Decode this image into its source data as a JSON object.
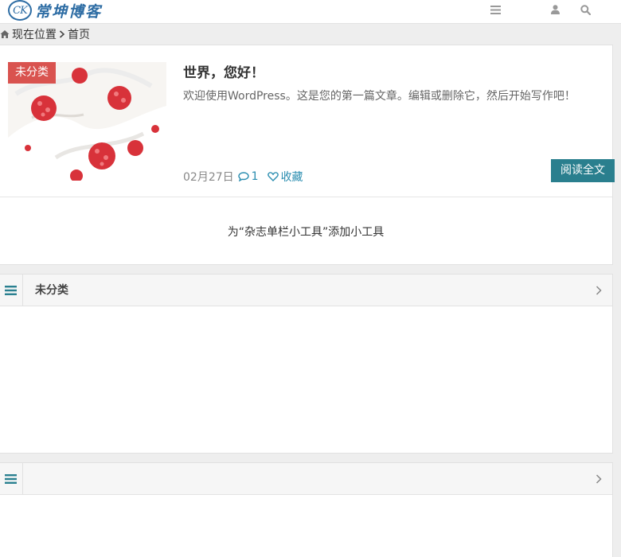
{
  "header": {
    "logo_mark": "CK",
    "logo_text": "常坤博客",
    "icons": [
      "menu-icon",
      "user-icon",
      "search-icon"
    ]
  },
  "breadcrumb": {
    "label": "现在位置",
    "home": "首页"
  },
  "post": {
    "category": "未分类",
    "title": "世界，您好！",
    "excerpt": "欢迎使用WordPress。这是您的第一篇文章。编辑或删除它，然后开始写作吧！",
    "date": "02月27日",
    "comments": "1",
    "favorite": "收藏",
    "read_more": "阅读全文"
  },
  "widget_note": "为“杂志单栏小工具”添加小工具",
  "sections": [
    {
      "name": "未分类"
    },
    {
      "name": ""
    }
  ],
  "colors": {
    "brand": "#2e6da4",
    "tag": "#d9534f",
    "accent": "#2a7f8e",
    "link": "#2a8db0"
  }
}
